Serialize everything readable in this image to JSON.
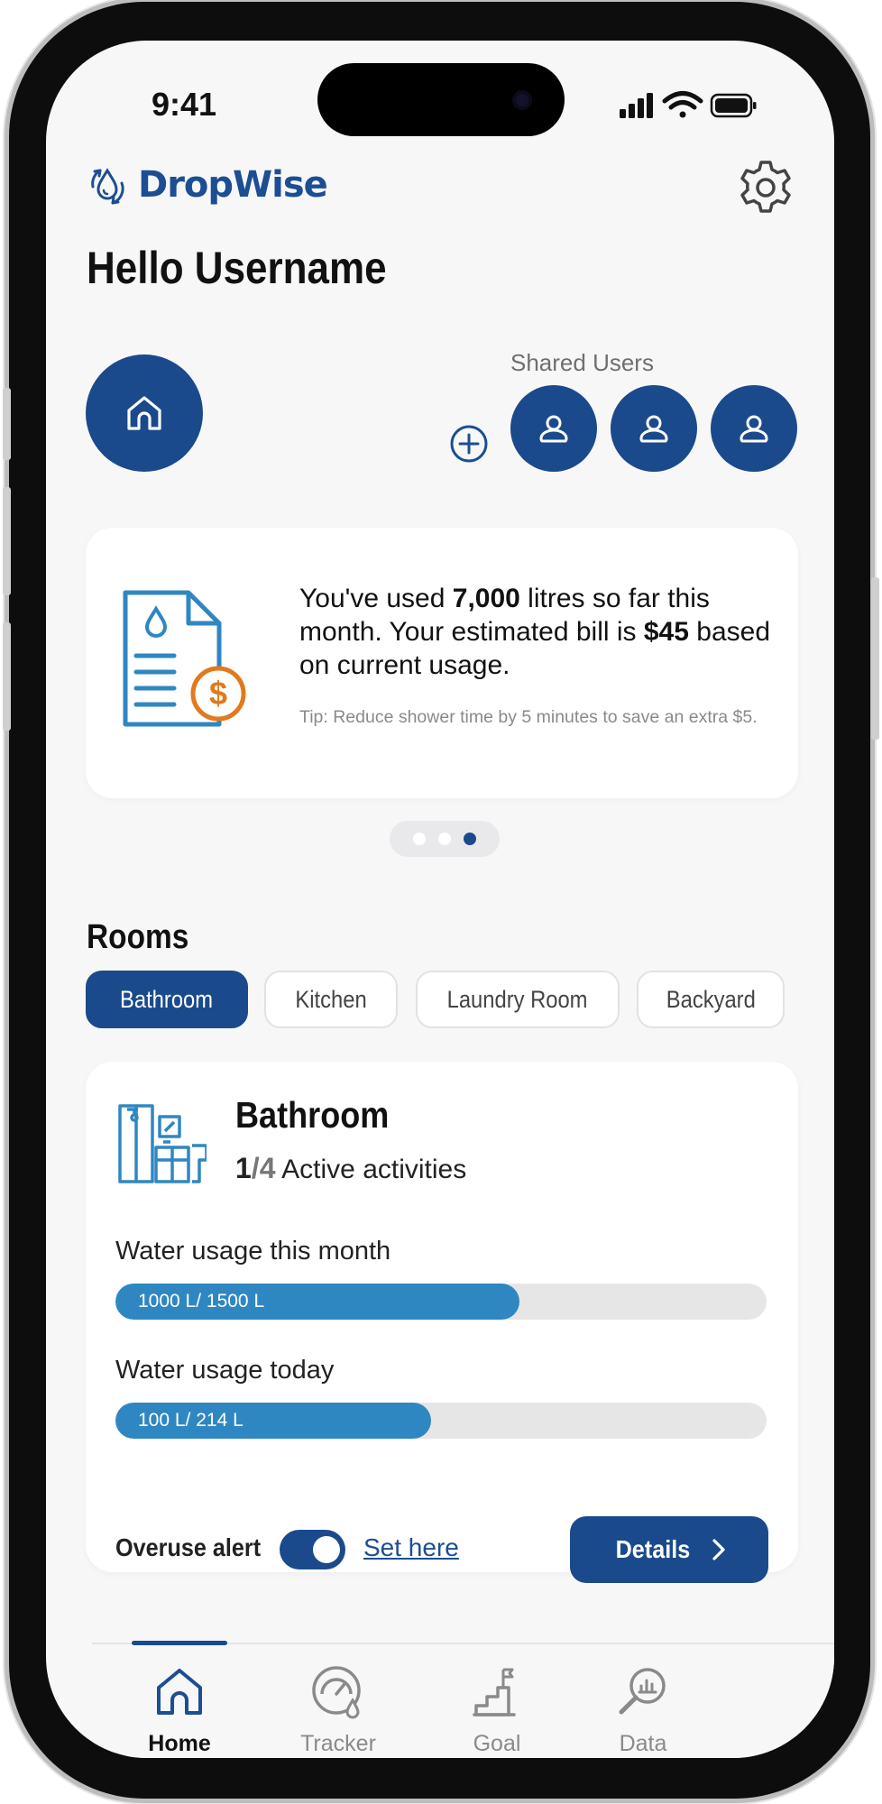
{
  "status_bar": {
    "time": "9:41"
  },
  "app": {
    "name": "DropWise"
  },
  "greeting": "Hello Username",
  "shared_users": {
    "label": "Shared Users"
  },
  "bill_card": {
    "text_pre": "You've used ",
    "litres": "7,000",
    "text_mid": " litres so far this month. Your estimated bill is ",
    "bill": "$45",
    "text_post": " based on current usage.",
    "tip": "Tip: Reduce shower time by 5 minutes to save an extra $5."
  },
  "carousel": {
    "count": 3,
    "active_index": 2
  },
  "rooms": {
    "title": "Rooms",
    "chips": [
      "Bathroom",
      "Kitchen",
      "Laundry Room",
      "Backyard"
    ],
    "selected": "Bathroom"
  },
  "room_card": {
    "name": "Bathroom",
    "active": "1",
    "separator": "/",
    "total": "4",
    "activities_label": "Active activities",
    "month_label": "Water usage this month",
    "month_value": "1000 L/ 1500 L",
    "month_fraction": 0.62,
    "today_label": "Water usage today",
    "today_value": "100 L/ 214 L",
    "today_fraction": 0.485,
    "overuse_label": "Overuse alert",
    "overuse_enabled": true,
    "set_here": "Set here",
    "details_label": "Details"
  },
  "nav": {
    "items": [
      "Home",
      "Tracker",
      "Goal",
      "Data"
    ],
    "active": "Home"
  },
  "colors": {
    "primary": "#1a4a8b",
    "bar_fill": "#2f87c2",
    "accent_orange": "#e07a1c",
    "background": "#f7f7f8"
  },
  "icons": {
    "logo": "water-drop-cycle-icon",
    "settings": "gear-icon",
    "home": "home-icon",
    "add_user": "plus-circle-icon",
    "user": "user-icon",
    "bill": "bill-document-icon",
    "room": "bathroom-icon",
    "details": "chevron-right-icon",
    "tracker": "gauge-icon",
    "goal": "goal-steps-icon",
    "data": "data-search-icon"
  }
}
